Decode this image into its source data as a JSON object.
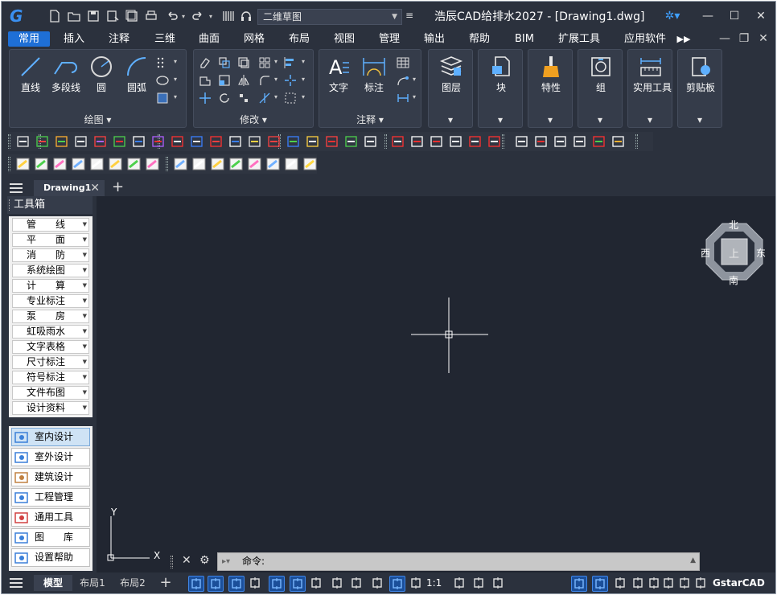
{
  "titlebar": {
    "workspace": "二维草图",
    "title": "浩辰CAD给排水2027 - [Drawing1.dwg]"
  },
  "menu": [
    {
      "label": "常用",
      "active": true
    },
    {
      "label": "插入"
    },
    {
      "label": "注释"
    },
    {
      "label": "三维"
    },
    {
      "label": "曲面"
    },
    {
      "label": "网格"
    },
    {
      "label": "布局"
    },
    {
      "label": "视图"
    },
    {
      "label": "管理"
    },
    {
      "label": "输出"
    },
    {
      "label": "帮助"
    },
    {
      "label": "BIM"
    },
    {
      "label": "扩展工具"
    },
    {
      "label": "应用软件"
    }
  ],
  "ribbon": {
    "draw": {
      "footer": "绘图 ▾",
      "line": "直线",
      "polyline": "多段线",
      "circle": "圆",
      "arc": "圆弧"
    },
    "modify": {
      "footer": "修改 ▾"
    },
    "annotation": {
      "footer": "注释 ▾",
      "text": "文字",
      "dimension": "标注"
    },
    "layers": "图层",
    "block": "块",
    "properties": "特性",
    "group": "组",
    "utilities": "实用工具",
    "clipboard": "剪贴板"
  },
  "tabs": {
    "doc": "Drawing1"
  },
  "toolbox": {
    "title": "工具箱",
    "items": [
      "管　　线",
      "平　　面",
      "消　　防",
      "系统绘图",
      "计　　算",
      "专业标注",
      "泵　　房",
      "虹吸雨水",
      "文字表格",
      "尺寸标注",
      "符号标注",
      "文件布图",
      "设计资料"
    ],
    "categories": [
      "室内设计",
      "室外设计",
      "建筑设计",
      "工程管理",
      "通用工具",
      "图　　库",
      "设置帮助"
    ]
  },
  "viewcube": {
    "north": "北",
    "south": "南",
    "east": "东",
    "west": "西",
    "top": "上"
  },
  "ucs": {
    "x": "X",
    "y": "Y"
  },
  "command": {
    "prompt": "命令:"
  },
  "statusbar": {
    "model": "模型",
    "layout1": "布局1",
    "layout2": "布局2",
    "scale": "1:1",
    "brand": "GstarCAD"
  },
  "colors": {
    "accent": "#1e6fd6",
    "canvas": "#212631",
    "chrome": "#2b313d"
  }
}
